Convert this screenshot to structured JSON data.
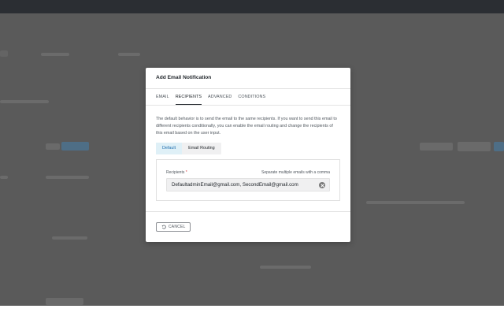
{
  "modal": {
    "title": "Add Email Notification",
    "tabs": [
      {
        "label": "EMAIL",
        "active": false
      },
      {
        "label": "RECIPIENTS",
        "active": true
      },
      {
        "label": "ADVANCED",
        "active": false
      },
      {
        "label": "CONDITIONS",
        "active": false
      }
    ],
    "description": "The default behavior is to send the email to the same recipients. If you want to send this email to different recipients conditionally, you can enable the email routing and change the recipients of this email based on the user input.",
    "routing": {
      "options": [
        {
          "label": "Default",
          "active": true
        },
        {
          "label": "Email Routing",
          "active": false
        }
      ]
    },
    "recipients": {
      "label": "Recipients",
      "required_mark": "*",
      "hint": "Separate multiple emails with a comma",
      "value": "DefaultadminEmail@gmail.com, SecondEmail@gmail.com"
    },
    "cancel_label": "CANCEL"
  },
  "colors": {
    "accent": "#2271b1",
    "active_tab_bg": "#dff0f7",
    "overlay": "#5a5a5a",
    "topbar": "#2b2e33"
  },
  "icons": {
    "clear": "clear-circle-icon",
    "cancel": "undo-icon"
  }
}
